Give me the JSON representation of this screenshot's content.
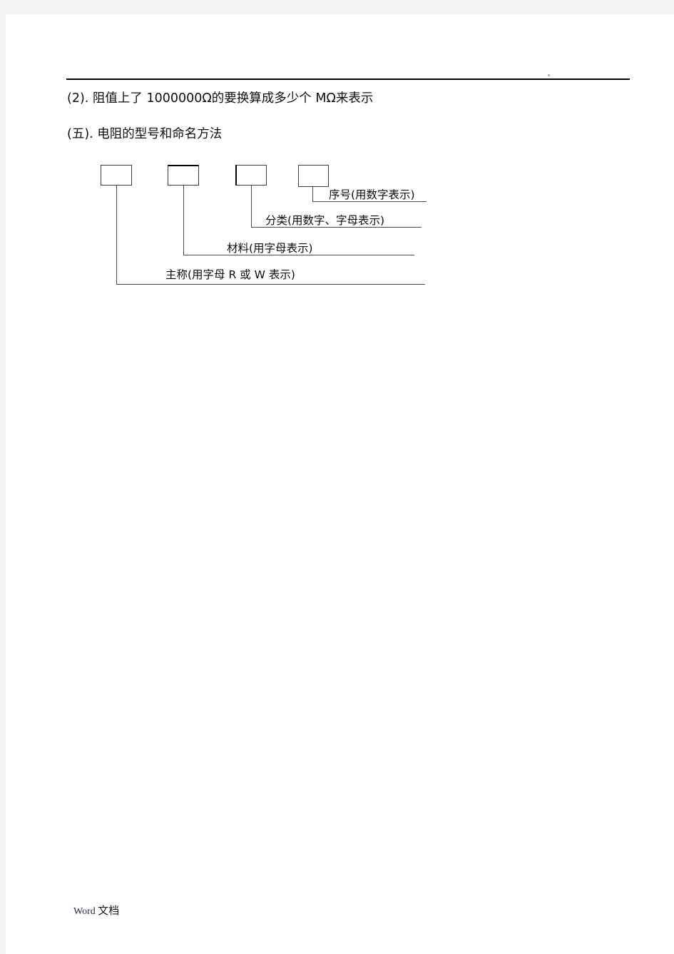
{
  "document": {
    "header_rule": true,
    "paragraphs": [
      {
        "id": "p1",
        "text": "(2).  阻值上了 1000000Ω的要换算成多少个 MΩ来表示"
      },
      {
        "id": "p2",
        "text": "(五).  电阻的型号和命名方法"
      }
    ],
    "footer": {
      "latin": "Word",
      "chinese": "文档"
    }
  },
  "diagram": {
    "name": "resistor-model-naming-diagram",
    "boxes": [
      {
        "id": "box1",
        "label": ""
      },
      {
        "id": "box2",
        "label": ""
      },
      {
        "id": "box3",
        "label": ""
      },
      {
        "id": "box4",
        "label": ""
      }
    ],
    "labels": [
      {
        "id": "label-serial",
        "text": "序号(用数字表示)"
      },
      {
        "id": "label-category",
        "text": "分类(用数字、字母表示)"
      },
      {
        "id": "label-material",
        "text": "材料(用字母表示)"
      },
      {
        "id": "label-mainname",
        "text": "主称(用字母 R 或 W 表示)"
      }
    ]
  }
}
